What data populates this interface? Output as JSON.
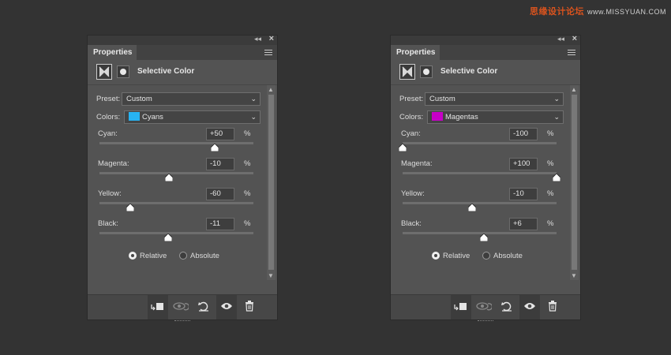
{
  "watermark": {
    "text": "思缘设计论坛",
    "site": "www.MISSYUAN.COM"
  },
  "panels": [
    {
      "tab": "Properties",
      "title": "Selective Color",
      "preset_label": "Preset:",
      "preset_value": "Custom",
      "colors_label": "Colors:",
      "colors_value": "Cyans",
      "swatch_color": "#27b3f2",
      "sliders": [
        {
          "label": "Cyan:",
          "value": "+50",
          "pct": "%",
          "level": 50
        },
        {
          "label": "Magenta:",
          "value": "-10",
          "pct": "%",
          "level": -10
        },
        {
          "label": "Yellow:",
          "value": "-60",
          "pct": "%",
          "level": -60
        },
        {
          "label": "Black:",
          "value": "-11",
          "pct": "%",
          "level": -11
        }
      ],
      "relative_label": "Relative",
      "absolute_label": "Absolute",
      "method": "Relative"
    },
    {
      "tab": "Properties",
      "title": "Selective Color",
      "preset_label": "Preset:",
      "preset_value": "Custom",
      "colors_label": "Colors:",
      "colors_value": "Magentas",
      "swatch_color": "#c800c8",
      "sliders": [
        {
          "label": "Cyan:",
          "value": "-100",
          "pct": "%",
          "level": -100
        },
        {
          "label": "Magenta:",
          "value": "+100",
          "pct": "%",
          "level": 100
        },
        {
          "label": "Yellow:",
          "value": "-10",
          "pct": "%",
          "level": -10
        },
        {
          "label": "Black:",
          "value": "+6",
          "pct": "%",
          "level": 6
        }
      ],
      "relative_label": "Relative",
      "absolute_label": "Absolute",
      "method": "Relative"
    }
  ],
  "icons": {
    "collapse": "double-chevron-left-icon",
    "close": "close-icon",
    "menu": "panel-menu-icon",
    "adjustment": "adjustment-layer-icon",
    "mask": "layer-mask-icon",
    "clip": "clip-to-layer-icon",
    "view_previous": "view-previous-state-icon",
    "reset": "reset-icon",
    "visibility": "eye-icon",
    "delete": "trash-icon"
  }
}
